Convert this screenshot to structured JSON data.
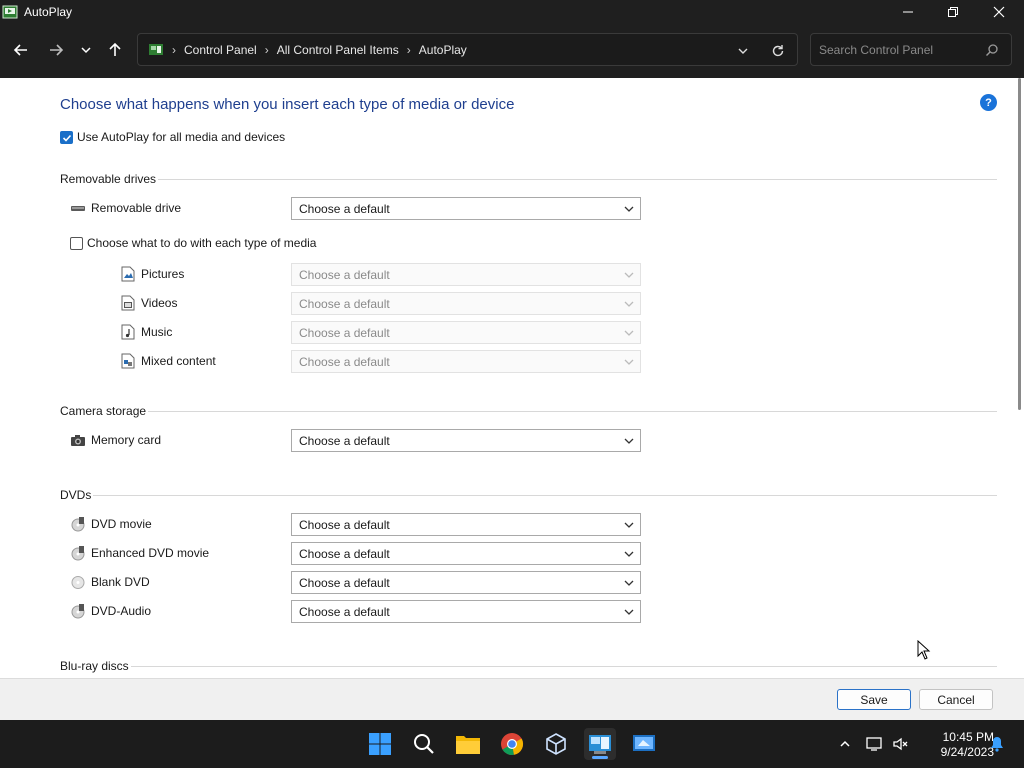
{
  "window": {
    "title": "AutoPlay",
    "icon": "autoplay-app-icon"
  },
  "nav": {
    "breadcrumb": [
      "Control Panel",
      "All Control Panel Items",
      "AutoPlay"
    ],
    "search_placeholder": "Search Control Panel"
  },
  "main": {
    "heading": "Choose what happens when you insert each type of media or device",
    "use_autoplay_label": "Use AutoPlay for all media and devices",
    "use_autoplay_checked": true,
    "help_label": "?"
  },
  "removable": {
    "section_title": "Removable drives",
    "drive_label": "Removable drive",
    "drive_value": "Choose a default",
    "media_checkbox_label": "Choose what to do with each type of media",
    "media_checkbox_checked": false,
    "media_items": [
      {
        "label": "Pictures",
        "value": "Choose a default"
      },
      {
        "label": "Videos",
        "value": "Choose a default"
      },
      {
        "label": "Music",
        "value": "Choose a default"
      },
      {
        "label": "Mixed content",
        "value": "Choose a default"
      }
    ]
  },
  "camera": {
    "section_title": "Camera storage",
    "memory_card_label": "Memory card",
    "memory_card_value": "Choose a default"
  },
  "dvds": {
    "section_title": "DVDs",
    "items": [
      {
        "label": "DVD movie",
        "value": "Choose a default"
      },
      {
        "label": "Enhanced DVD movie",
        "value": "Choose a default"
      },
      {
        "label": "Blank DVD",
        "value": "Choose a default"
      },
      {
        "label": "DVD-Audio",
        "value": "Choose a default"
      }
    ]
  },
  "bluray": {
    "section_title": "Blu-ray discs"
  },
  "buttons": {
    "save": "Save",
    "cancel": "Cancel"
  },
  "clock": {
    "time": "10:45 PM",
    "date": "9/24/2023"
  },
  "colors": {
    "accent": "#1a6fc8",
    "titlebar": "#1f1f1f",
    "heading": "#1f3f8f"
  }
}
